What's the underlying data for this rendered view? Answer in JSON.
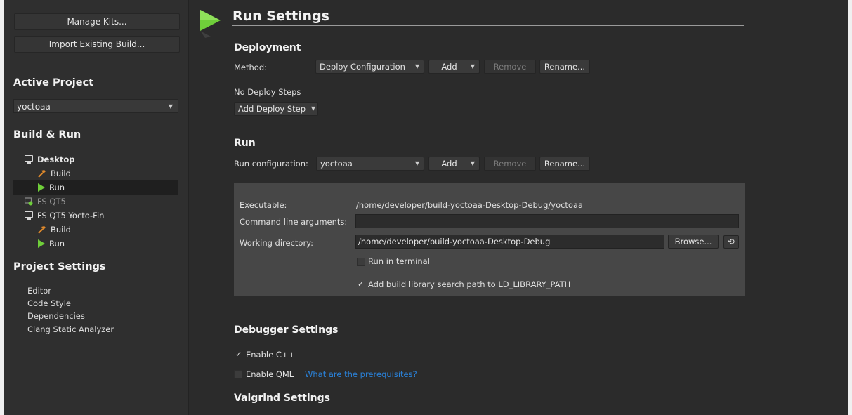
{
  "sidebar": {
    "manage_kits": "Manage Kits...",
    "import_build": "Import Existing Build...",
    "active_project_heading": "Active Project",
    "active_project_value": "yoctoaa",
    "build_run_heading": "Build & Run",
    "tree": {
      "desktop": "Desktop",
      "desktop_build": "Build",
      "desktop_run": "Run",
      "fs_qt5": "FS QT5",
      "fs_qt5_yocto": "FS QT5 Yocto-Fin",
      "yocto_build": "Build",
      "yocto_run": "Run"
    },
    "project_settings_heading": "Project Settings",
    "project_settings_items": [
      "Editor",
      "Code Style",
      "Dependencies",
      "Clang Static Analyzer"
    ]
  },
  "main": {
    "title": "Run Settings",
    "deployment": {
      "heading": "Deployment",
      "method_label": "Method:",
      "method_value": "Deploy Configuration",
      "add": "Add",
      "remove": "Remove",
      "rename": "Rename...",
      "no_steps": "No Deploy Steps",
      "add_step": "Add Deploy Step"
    },
    "run": {
      "heading": "Run",
      "config_label": "Run configuration:",
      "config_value": "yoctoaa",
      "add": "Add",
      "remove": "Remove",
      "rename": "Rename...",
      "executable_label": "Executable:",
      "executable_value": "/home/developer/build-yoctoaa-Desktop-Debug/yoctoaa",
      "args_label": "Command line arguments:",
      "args_value": "",
      "workdir_label": "Working directory:",
      "workdir_value": "/home/developer/build-yoctoaa-Desktop-Debug",
      "browse": "Browse...",
      "run_in_terminal": "Run in terminal",
      "run_in_terminal_checked": false,
      "add_lib_path": "Add build library search path to LD_LIBRARY_PATH",
      "add_lib_path_checked": true
    },
    "debugger": {
      "heading": "Debugger Settings",
      "enable_cpp": "Enable C++",
      "enable_cpp_checked": true,
      "enable_qml": "Enable QML",
      "enable_qml_checked": false,
      "prereq_link": "What are the prerequisites?"
    },
    "valgrind": {
      "heading": "Valgrind Settings"
    }
  },
  "colors": {
    "accent_green": "#6fce3a",
    "link_blue": "#2a82da",
    "background": "#2b2b2b",
    "panel": "#474747",
    "selection": "#1f1f1f"
  },
  "icons": {
    "run_mode": "play-triangle-icon",
    "device": "monitor-icon",
    "build": "hammer-icon",
    "run": "play-icon",
    "device_disconnected": "device-error-icon",
    "reset": "reset-icon"
  }
}
